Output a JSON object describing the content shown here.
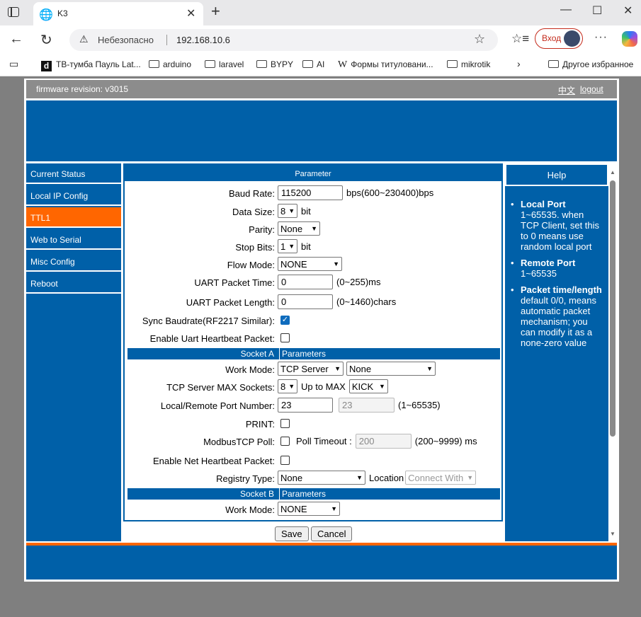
{
  "browser": {
    "tab_title": "K3",
    "security_label": "Небезопасно",
    "url": "192.168.10.6",
    "login_label": "Вход",
    "bookmarks": [
      {
        "label": "ТВ-тумба Пауль Lat...",
        "icon": "d-logo"
      },
      {
        "label": "arduino",
        "icon": "folder-icon"
      },
      {
        "label": "laravel",
        "icon": "folder-icon"
      },
      {
        "label": "BYPY",
        "icon": "folder-icon"
      },
      {
        "label": "AI",
        "icon": "folder-icon"
      },
      {
        "label": "Формы титуловани...",
        "icon": "wikipedia-icon"
      },
      {
        "label": "mikrotik",
        "icon": "folder-icon"
      }
    ],
    "other_bookmarks": "Другое избранное"
  },
  "header": {
    "firmware": "firmware revision:  v3015",
    "lang_link": "中文",
    "logout_link": "logout"
  },
  "sidebar": {
    "items": [
      "Current Status",
      "Local IP Config",
      "TTL1",
      "Web to Serial",
      "Misc Config",
      "Reboot"
    ],
    "active": "TTL1"
  },
  "main": {
    "title": "Parameter",
    "baud_label": "Baud Rate:",
    "baud_value": "115200",
    "baud_hint": "bps(600~230400)bps",
    "databits_label": "Data Size:",
    "databits_value": "8",
    "databits_unit": "bit",
    "parity_label": "Parity:",
    "parity_value": "None",
    "stopbits_label": "Stop Bits:",
    "stopbits_value": "1",
    "stopbits_unit": "bit",
    "flow_label": "Flow Mode:",
    "flow_value": "NONE",
    "pkt_time_label": "UART Packet Time:",
    "pkt_time_value": "0",
    "pkt_time_hint": "(0~255)ms",
    "pkt_len_label": "UART Packet Length:",
    "pkt_len_value": "0",
    "pkt_len_hint": "(0~1460)chars",
    "sync_label": "Sync Baudrate(RF2217 Similar):",
    "sync_checked": true,
    "uart_hb_label": "Enable Uart Heartbeat Packet:",
    "socketA_left": "Socket A",
    "socketA_right": "Parameters",
    "workmode_label": "Work Mode:",
    "workmode_value": "TCP Server",
    "workmode_sub": "None",
    "maxsock_label": "TCP Server MAX Sockets:",
    "maxsock_value": "8",
    "upto_label": "Up to MAX",
    "upto_value": "KICK",
    "port_label": "Local/Remote Port Number:",
    "local_port": "23",
    "remote_port": "23",
    "port_hint": "(1~65535)",
    "print_label": "PRINT:",
    "modbus_label": "ModbusTCP Poll:",
    "poll_timeout_label": "Poll Timeout :",
    "poll_timeout_value": "200",
    "poll_timeout_hint": "(200~9999) ms",
    "net_hb_label": "Enable Net Heartbeat Packet:",
    "registry_label": "Registry Type:",
    "registry_value": "None",
    "location_label": "Location",
    "location_value": "Connect With",
    "socketB_left": "Socket B",
    "socketB_right": "Parameters",
    "workmodeB_label": "Work Mode:",
    "workmodeB_value": "NONE"
  },
  "buttons": {
    "save": "Save",
    "cancel": "Cancel"
  },
  "help": {
    "title": "Help",
    "items": [
      {
        "head": "Local Port",
        "body": "1~65535. when TCP Client, set this to 0 means use random local port"
      },
      {
        "head": "Remote Port",
        "body": "1~65535"
      },
      {
        "head": "Packet time/length",
        "body": "default 0/0, means automatic packet mechanism; you can modify it as a none-zero value"
      }
    ]
  }
}
